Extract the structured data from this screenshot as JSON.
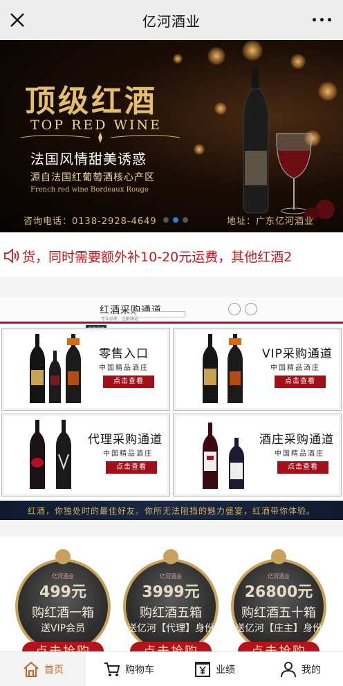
{
  "header": {
    "title": "亿河酒业"
  },
  "banner": {
    "headline": "顶级红酒",
    "subtitle_en": "TOP RED WINE",
    "tagline": "法国风情甜美诱惑",
    "origin": "源自法国红葡萄酒核心产区",
    "origin_en": "French red wine  Bordeaux Rouge",
    "phone": "咨询电话：0138-2928-4649",
    "address": "地址：广东亿河酒业",
    "slide_count": 3,
    "active_slide": 2
  },
  "notice": {
    "text": "货，同时需要额外补10-20元运费，其他红酒2"
  },
  "channels": {
    "title": "红酒采购通道",
    "sub": "专业品质 · 佳酿臻选",
    "nav": "采购通道",
    "cards": [
      {
        "title": "零售入口",
        "sub": "中国精品酒庄",
        "button": "点击查看"
      },
      {
        "title": "VIP采购通道",
        "sub": "中国精品酒庄",
        "button": "点击查看"
      },
      {
        "title": "代理采购通道",
        "sub": "中国精品酒庄",
        "button": "点击查看"
      },
      {
        "title": "酒庄采购通道",
        "sub": "中国精品酒庄",
        "button": "点击查看"
      }
    ],
    "footer": "红酒，你独处时的最佳好友。你所无法阻挡的魅力盛宴，红酒带你体验。"
  },
  "packages": [
    {
      "brand": "亿河酒业",
      "price": "499元",
      "line1": "购红酒一箱",
      "line2": "送VIP会员",
      "cta": "点击抢购"
    },
    {
      "brand": "亿河酒业",
      "price": "3999元",
      "line1": "购红酒五箱",
      "line2": "送亿河【代理】身份",
      "cta": "点击抢购"
    },
    {
      "brand": "亿河酒业",
      "price": "26800元",
      "line1": "购红酒五十箱",
      "line2": "送亿河【庄主】身份",
      "cta": "点击抢购"
    }
  ],
  "tabbar": {
    "items": [
      {
        "label": "首页",
        "icon": "home-icon",
        "active": true
      },
      {
        "label": "购物车",
        "icon": "cart-icon",
        "active": false
      },
      {
        "label": "业绩",
        "icon": "yen-box-icon",
        "active": false
      },
      {
        "label": "我的",
        "icon": "user-icon",
        "active": false
      }
    ]
  },
  "colors": {
    "accent_red": "#c4161c",
    "tab_active": "#d0651f",
    "gold": "#e3bf6c"
  }
}
